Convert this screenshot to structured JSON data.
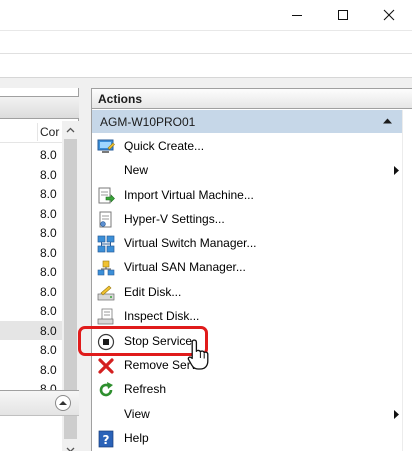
{
  "window": {
    "controls": {
      "minimize_icon": "minimize-icon",
      "maximize_icon": "maximize-icon",
      "close_icon": "close-icon"
    }
  },
  "center_pane": {
    "column_header": "Cor",
    "rows": [
      "8.0",
      "8.0",
      "8.0",
      "8.0",
      "8.0",
      "8.0",
      "8.0",
      "8.0",
      "8.0",
      "8.0",
      "8.0",
      "8.0"
    ],
    "selected_row_index": 9,
    "last_row_partial": "8.0"
  },
  "actions": {
    "title": "Actions",
    "group": "AGM-W10PRO01",
    "items": [
      {
        "label": "Quick Create...",
        "icon": "quick-create-icon"
      },
      {
        "label": "New",
        "icon": "",
        "submenu": true
      },
      {
        "label": "Import Virtual Machine...",
        "icon": "import-vm-icon"
      },
      {
        "label": "Hyper-V Settings...",
        "icon": "settings-icon"
      },
      {
        "label": "Virtual Switch Manager...",
        "icon": "virtual-switch-icon"
      },
      {
        "label": "Virtual SAN Manager...",
        "icon": "virtual-san-icon"
      },
      {
        "label": "Edit Disk...",
        "icon": "edit-disk-icon"
      },
      {
        "label": "Inspect Disk...",
        "icon": "inspect-disk-icon"
      },
      {
        "label": "Stop Service",
        "icon": "stop-icon"
      },
      {
        "label": "Remove Serv",
        "icon": "remove-icon"
      },
      {
        "label": "Refresh",
        "icon": "refresh-icon"
      },
      {
        "label": "View",
        "icon": "",
        "submenu": true
      },
      {
        "label": "Help",
        "icon": "help-icon"
      }
    ]
  },
  "colors": {
    "group_header": "#c6d7e8",
    "highlight": "#e01b1b",
    "remove_red": "#d42020",
    "refresh_green": "#2f8f2f",
    "help_blue": "#2a62b8"
  }
}
